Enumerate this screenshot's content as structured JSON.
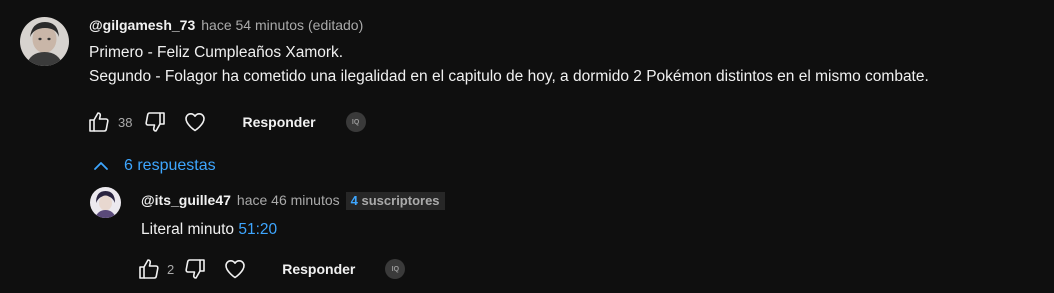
{
  "comment": {
    "author": "@gilgamesh_73",
    "time": "hace 54 minutos",
    "edited": "(editado)",
    "lines": [
      "Primero - Feliz Cumpleaños Xamork.",
      "Segundo - Folagor ha cometido una ilegalidad en el capitulo de hoy, a dormido 2 Pokémon distintos en el mismo combate."
    ],
    "likes": "38",
    "reply_label": "Responder",
    "iq_label": "IQ"
  },
  "replies_toggle": {
    "label": "6 respuestas"
  },
  "reply": {
    "author": "@its_guille47",
    "time": "hace 46 minutos",
    "badge_number": "4",
    "badge_label": "suscriptores",
    "text": "Literal minuto",
    "timestamp": "51:20",
    "likes": "2",
    "reply_label": "Responder",
    "iq_label": "IQ"
  },
  "colors": {
    "background": "#0f0f0f",
    "link": "#3ea6ff",
    "text": "#f1f1f1",
    "muted": "#aaaaaa"
  },
  "icons": [
    "thumbs-up-icon",
    "thumbs-down-icon",
    "heart-icon",
    "chevron-up-icon",
    "iq-icon"
  ]
}
